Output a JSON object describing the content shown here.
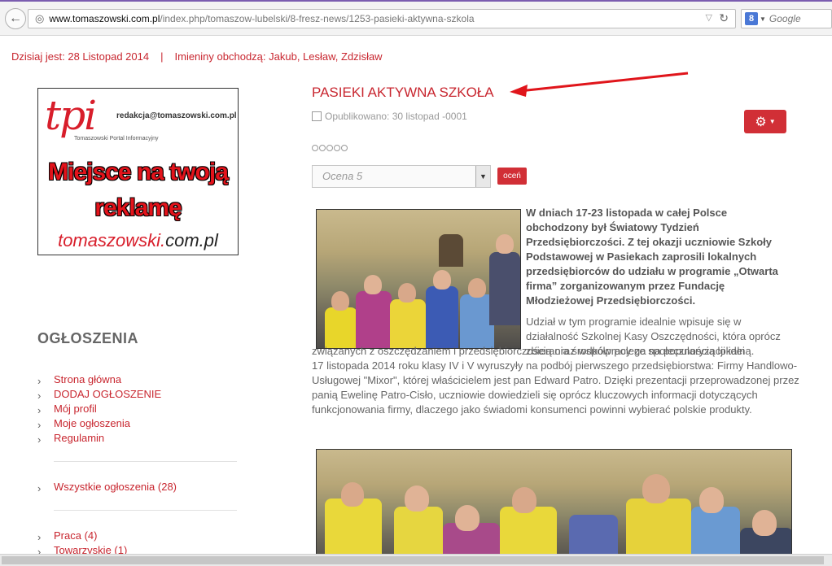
{
  "browser": {
    "url_host": "www.tomaszowski.com.pl",
    "url_path": "/index.php/tomaszow-lubelski/8-fresz-news/1253-pasieki-aktywna-szkola",
    "search_placeholder": "Google",
    "search_engine_letter": "8"
  },
  "topline": {
    "date": "Dzisiaj jest: 28 Listopad 2014",
    "separator": "|",
    "names_day": "Imieniny obchodzą: Jakub, Lesław, Zdzisław"
  },
  "banner": {
    "logo": "tpi",
    "email": "redakcja@tomaszowski.com.pl",
    "subtitle": "Tomaszowski Portal Informacyjny",
    "line1": "Miejsce na twoją",
    "line2": "reklamę",
    "site_red": "tomaszowski.",
    "site_dark": "com.pl"
  },
  "sidebar": {
    "title": "OGŁOSZENIA",
    "menu1": [
      "Strona główna",
      "DODAJ OGŁOSZENIE",
      "Mój profil",
      "Moje ogłoszenia",
      "Regulamin"
    ],
    "menu2": [
      "Wszystkie ogłoszenia (28)"
    ],
    "menu3": [
      "Praca (4)",
      "Towarzyskie (1)"
    ]
  },
  "article": {
    "title": "PASIEKI AKTYWNA SZKOŁA",
    "published": "Opublikowano: 30 listopad -0001",
    "rating_select": "Ocena 5",
    "vote_button": "oceń",
    "lead": "W dniach 17-23 listopada w całej Polsce obchodzony był Światowy Tydzień Przedsiębiorczości. Z tej okazji uczniowie Szkoły Podstawowej w Pasiekach zaprosili lokalnych przedsiębiorców do udziału w programie „Otwarta firma” zorganizowanym przez Fundację Młodzieżowej Przedsiębiorczości.",
    "body1": "Udział w tym programie idealnie wpisuje się w działalność Szkolnej Kasy Oszczędności, która oprócz zbierania środków polega na popularyzacji idei",
    "body2_line1": "związanych z oszczędzaniem i przedsiębiorczością oraz współpracy ze społecznością lokalną.",
    "body2_rest": "17 listopada 2014 roku klasy IV i V wyruszyły na podbój pierwszego przedsiębiorstwa: Firmy Handlowo-Usługowej \"Mixor\", której właścicielem jest pan Edward Patro. Dzięki prezentacji przeprowadzonej przez panią Ewelinę Patro-Cisło, uczniowie dowiedzieli się oprócz kluczowych informacji dotyczących funkcjonowania firmy, dlaczego jako świadomi konsumenci powinni wybierać polskie produkty."
  },
  "colors": {
    "accent_red": "#c8262f",
    "button_red": "#d12f36"
  }
}
